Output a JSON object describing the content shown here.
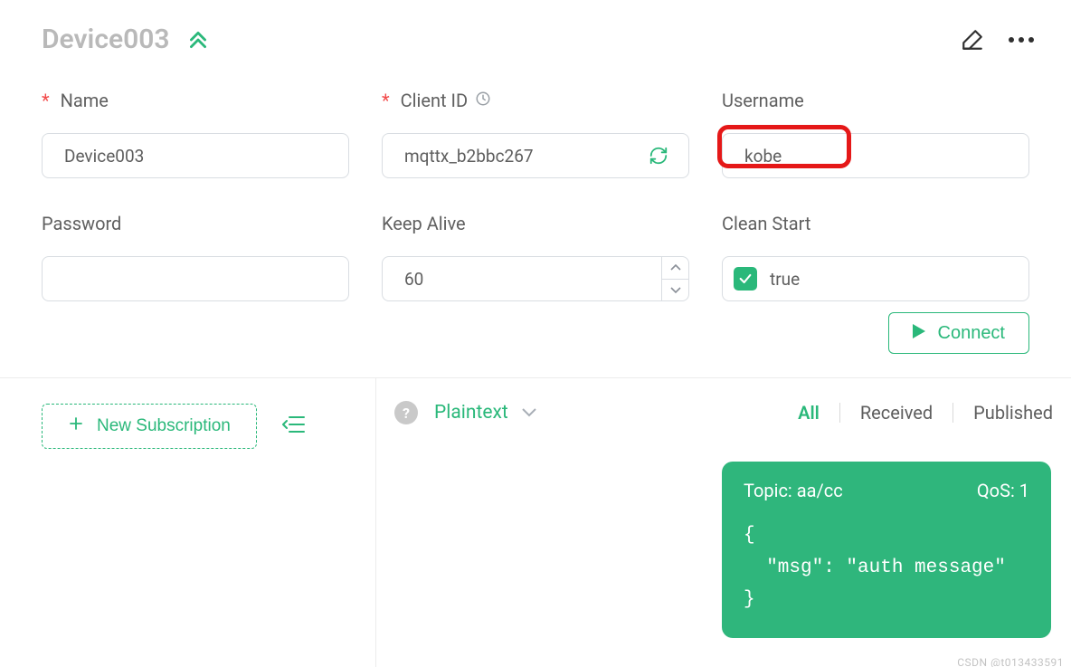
{
  "header": {
    "title": "Device003"
  },
  "fields": {
    "name": {
      "label": "Name",
      "value": "Device003"
    },
    "clientId": {
      "label": "Client ID",
      "value": "mqttx_b2bbc267"
    },
    "username": {
      "label": "Username",
      "value": "kobe"
    },
    "password": {
      "label": "Password",
      "value": ""
    },
    "keepAlive": {
      "label": "Keep Alive",
      "value": "60"
    },
    "cleanStart": {
      "label": "Clean Start",
      "value": "true"
    }
  },
  "buttons": {
    "connect": "Connect",
    "newSubscription": "New Subscription"
  },
  "messages": {
    "formatDropdown": "Plaintext",
    "filters": {
      "all": "All",
      "received": "Received",
      "published": "Published"
    },
    "bubble": {
      "topicLabel": "Topic: aa/cc",
      "qosLabel": "QoS: 1",
      "body": "{\n  \"msg\": \"auth message\"\n}"
    }
  },
  "watermark": "CSDN @t013433591"
}
